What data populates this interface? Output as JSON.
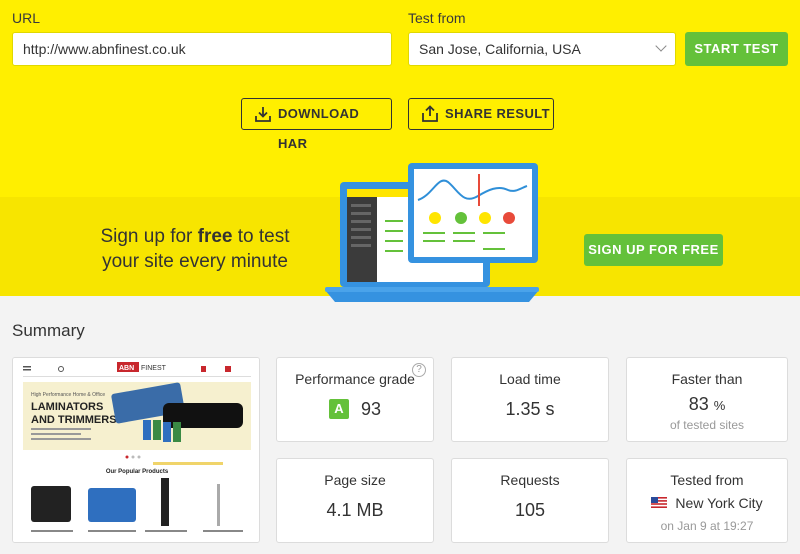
{
  "form": {
    "url_label": "URL",
    "url_value": "http://www.abnfinest.co.uk",
    "test_from_label": "Test from",
    "test_from_value": "San Jose, California, USA",
    "start_label": "START TEST"
  },
  "actions": {
    "download_har": "DOWNLOAD HAR",
    "share_result": "SHARE RESULT"
  },
  "promo": {
    "line1_pre": "Sign up for ",
    "line1_bold": "free",
    "line1_post": " to test",
    "line2": "your site every minute",
    "signup_label": "SIGN UP FOR FREE"
  },
  "summary": {
    "title": "Summary",
    "performance": {
      "label": "Performance grade",
      "grade": "A",
      "score": "93",
      "help": "?"
    },
    "load_time": {
      "label": "Load time",
      "value": "1.35 s"
    },
    "faster": {
      "label": "Faster than",
      "value": "83",
      "unit": "%",
      "sub": "of tested sites"
    },
    "page_size": {
      "label": "Page size",
      "value": "4.1 MB"
    },
    "requests": {
      "label": "Requests",
      "value": "105"
    },
    "tested_from": {
      "label": "Tested from",
      "location": "New York City",
      "time": "on Jan 9 at 19:27"
    }
  },
  "screenshot": {
    "logo_left": "ABN",
    "logo_right": "FINEST",
    "banner_small": "High Performance Home & Office",
    "banner_title1": "LAMINATORS",
    "banner_title2": "AND TRIMMERS",
    "section_title": "Our Popular Products"
  },
  "colors": {
    "brand_yellow": "#ffef00",
    "accent_green": "#64c13a",
    "chart_blue": "#2f8fd8",
    "logo_red": "#c8272d"
  }
}
